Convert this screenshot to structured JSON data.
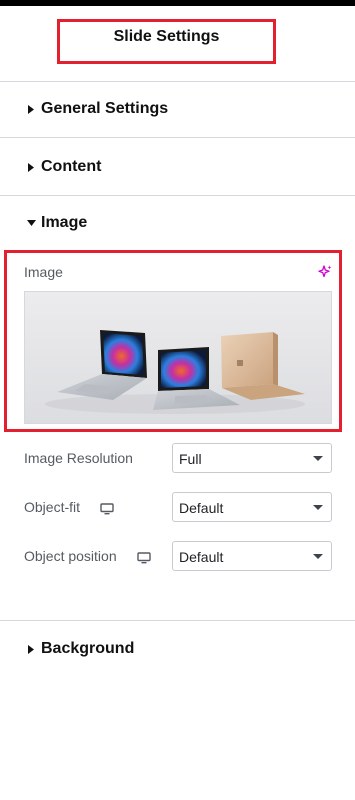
{
  "header": {
    "title": "Slide Settings"
  },
  "sections": {
    "general": {
      "label": "General Settings"
    },
    "content": {
      "label": "Content"
    },
    "image": {
      "label": "Image"
    },
    "background": {
      "label": "Background"
    }
  },
  "image_panel": {
    "image_label": "Image",
    "ai_icon": "sparkle-icon",
    "resolution": {
      "label": "Image Resolution",
      "value": "Full"
    },
    "object_fit": {
      "label": "Object-fit",
      "value": "Default",
      "icon": "desktop-icon"
    },
    "object_position": {
      "label": "Object position",
      "value": "Default",
      "icon": "desktop-icon"
    }
  },
  "colors": {
    "highlight": "#e3202f",
    "accent": "#d004d4",
    "divider": "#d5d8dc"
  }
}
